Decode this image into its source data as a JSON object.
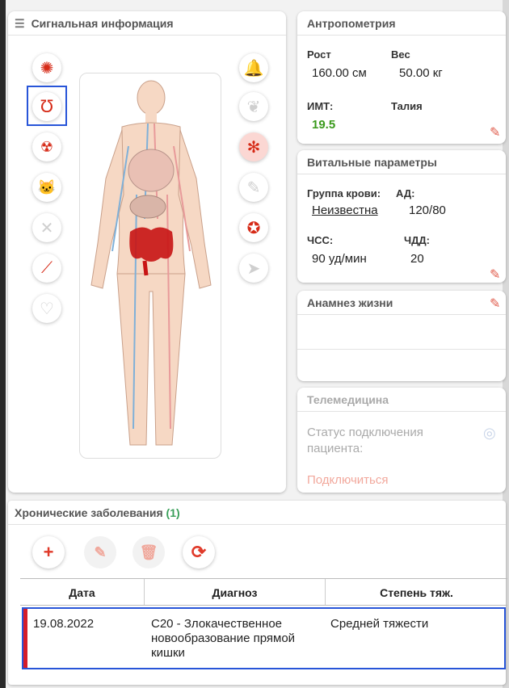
{
  "signal": {
    "title": "Сигнальная информация"
  },
  "anthro": {
    "title": "Антропометрия",
    "height_label": "Рост",
    "height_value": "160.00 см",
    "weight_label": "Вес",
    "weight_value": "50.00 кг",
    "bmi_label": "ИМТ:",
    "bmi_value": "19.5",
    "waist_label": "Талия"
  },
  "vitals": {
    "title": "Витальные параметры",
    "blood_label": "Группа крови:",
    "blood_value": "Неизвестна",
    "bp_label": "АД:",
    "bp_value": "120/80",
    "hr_label": "ЧСС:",
    "hr_value": "90 уд/мин",
    "rr_label": "ЧДД:",
    "rr_value": "20"
  },
  "anamnesis": {
    "title": "Анамнез жизни"
  },
  "telemed": {
    "title": "Телемедицина",
    "status": "Статус подключения пациента:",
    "connect": "Подключиться"
  },
  "chronic": {
    "title": "Хронические заболевания",
    "count": "(1)",
    "columns": [
      "Дата",
      "Диагноз",
      "Степень тяж."
    ],
    "rows": [
      {
        "date": "19.08.2022",
        "diagnosis": "C20 - Злокачественное новообразование прямой кишки",
        "severity": "Средней тяжести"
      }
    ]
  },
  "colors": {
    "accent_red": "#d62b18",
    "selection_blue": "#2855d8",
    "bmi_green": "#3a9a1c"
  },
  "icons": {
    "left": [
      "allergy-icon",
      "stethoscope-icon",
      "radiation-icon",
      "cat-allergy-icon",
      "prosthesis-icon",
      "scalpel-icon",
      "heart-icon"
    ],
    "right": [
      "alarm-icon",
      "lungs-icon",
      "virus-icon",
      "syringe-icon",
      "pregnancy-icon",
      "paper-plane-icon"
    ]
  }
}
